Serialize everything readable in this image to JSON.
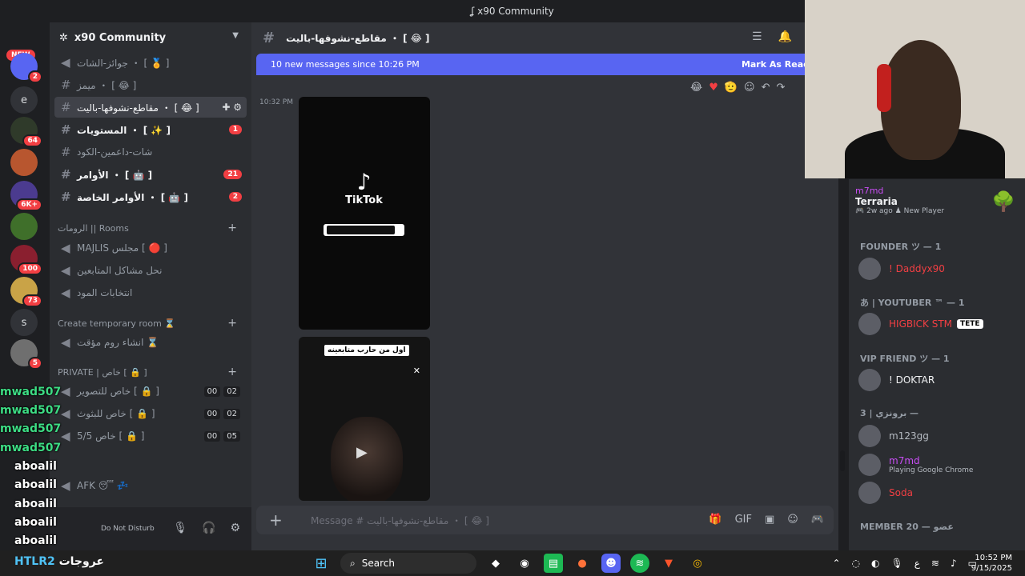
{
  "window": {
    "title": "x90 Community"
  },
  "servers": {
    "new_label": "NEW",
    "items": [
      {
        "label": "",
        "badge": "2"
      },
      {
        "label": "e",
        "badge": ""
      },
      {
        "label": "",
        "badge": "64"
      },
      {
        "label": "",
        "badge": ""
      },
      {
        "label": "",
        "badge": "6K+"
      },
      {
        "label": "",
        "badge": ""
      },
      {
        "label": "",
        "badge": "100"
      },
      {
        "label": "",
        "badge": "73"
      },
      {
        "label": "s",
        "badge": ""
      },
      {
        "label": "",
        "badge": "5"
      }
    ]
  },
  "guild": {
    "name": "x90 Community"
  },
  "channels": [
    {
      "name": "جوائز-الشات ・ [ 🏅 ]"
    },
    {
      "name": "ميمز ・ [ 😂 ]"
    },
    {
      "name": "مقاطع-نشوفها-باليت ・ [ 😂 ]"
    },
    {
      "name": "المستويات ・ [ ✨ ]",
      "badge": "1"
    },
    {
      "name": "شات-داعمين-الكود"
    },
    {
      "name": "الأوامر ・ [ 🤖 ]",
      "badge": "21"
    },
    {
      "name": "الأوامر الخاصة ・ [ 🤖 ]",
      "badge": "2"
    }
  ],
  "categories": {
    "rooms": "الرومات || Rooms",
    "temp": "Create temporary room ⌛",
    "private": "PRIVATE | خاص [ 🔒 ]"
  },
  "voice": {
    "majlis": "MAJLIS مجلس [ 🔴 ]",
    "solve": "نحل مشاكل المتابعين",
    "elections": "انتخابات المود",
    "create": "انشاء روم مؤقت ⌛",
    "private1": {
      "name": "خاص للتصوير [ 🔒 ]",
      "c1": "00",
      "c2": "02"
    },
    "private2": {
      "name": "خاص للبثوث [ 🔒 ]",
      "c1": "00",
      "c2": "02"
    },
    "private3": {
      "name": "5/5 خاص [ 🔒 ]",
      "c1": "00",
      "c2": "05"
    },
    "afk": "AFK 😴 💤"
  },
  "user_status": "Do Not Disturb",
  "chat": {
    "channel": "مقاطع-نشوفها-باليت ・ [ 😂 ]",
    "new_messages": "10 new messages since 10:26 PM",
    "mark_read": "Mark As Read",
    "timestamp": "10:32 PM",
    "video1_brand": "TikTok",
    "video2_label": "اول من حارب متابعينه",
    "composer_placeholder": "Message # مقاطع-نشوفها-باليت ・ [ 😂 ]"
  },
  "members": {
    "activity": {
      "name": "m7md",
      "game": "Terraria",
      "meta": "2w ago",
      "tag": "New Player"
    },
    "roles": [
      {
        "label": "FOUNDER ツ — 1"
      },
      {
        "label": "あ | YOUTUBER ™ — 1"
      },
      {
        "label": "VIP FRIEND ツ — 1"
      },
      {
        "label": "برونزي | 3 —"
      },
      {
        "label": "MEMBER 20 — عضو"
      }
    ],
    "list": [
      {
        "name": "! Daddyx90",
        "color": "#f23f43"
      },
      {
        "name": "HIGBICK STM",
        "color": "#f23f43",
        "tag": "TETE"
      },
      {
        "name": "! DOKTAR",
        "color": "#f2f3f5"
      },
      {
        "name": "m123gg",
        "color": "#b5bac1"
      },
      {
        "name": "m7md",
        "color": "#c94ef5",
        "status": "Playing Google Chrome"
      },
      {
        "name": "Soda",
        "color": "#f23f43"
      }
    ]
  },
  "overlay": {
    "lines": [
      {
        "text": "mwad507",
        "color": "#3ddc84"
      },
      {
        "text": "mwad507",
        "color": "#3ddc84"
      },
      {
        "text": "mwad507",
        "color": "#3ddc84"
      },
      {
        "text": "mwad507",
        "color": "#3ddc84"
      },
      {
        "text": "aboalil",
        "color": "#ffffff"
      },
      {
        "text": "aboalil",
        "color": "#ffffff"
      },
      {
        "text": "aboalil",
        "color": "#ffffff"
      },
      {
        "text": "aboalil",
        "color": "#ffffff"
      },
      {
        "text": "aboalil",
        "color": "#ffffff"
      }
    ]
  },
  "taskbar": {
    "left_a": "HTLR2",
    "left_b": "عروجات",
    "search": "Search",
    "time": "10:52 PM",
    "date": "9/15/2025"
  }
}
